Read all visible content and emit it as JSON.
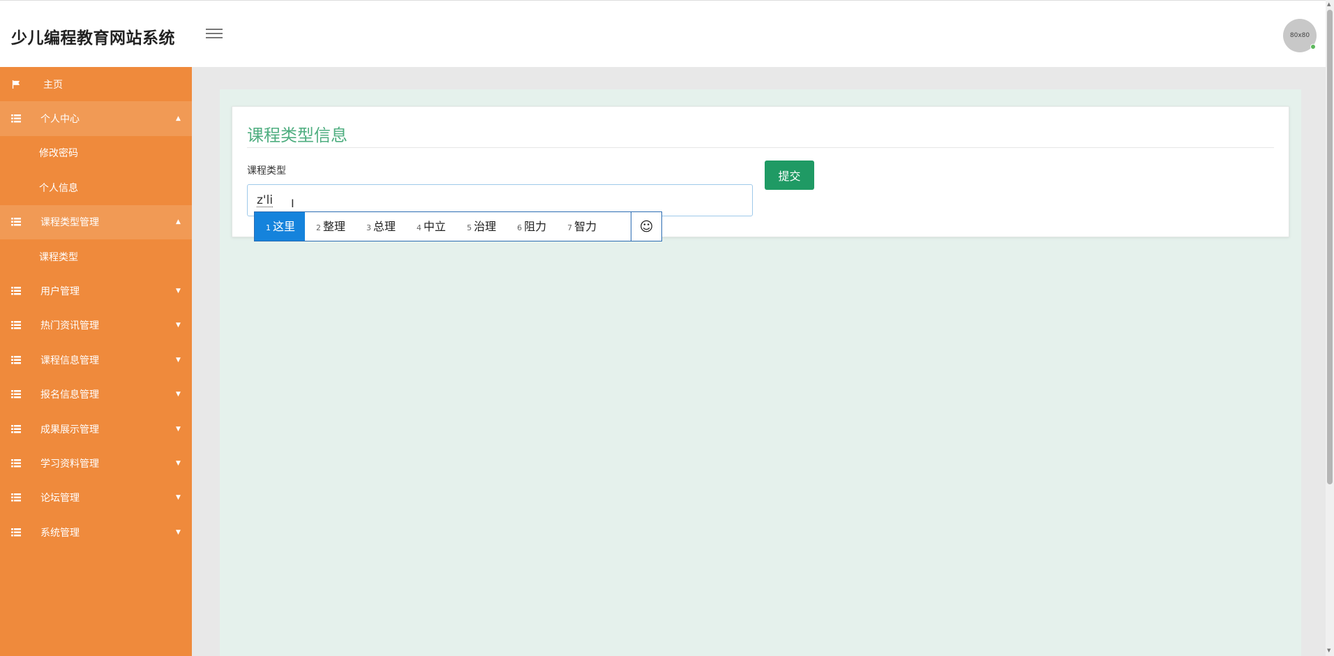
{
  "header": {
    "app_title": "少儿编程教育网站系统",
    "avatar_text": "80x80",
    "menu_icon": "hamburger-icon"
  },
  "sidebar": {
    "items": [
      {
        "label": "主页",
        "icon": "flag-icon",
        "arrow": ""
      },
      {
        "label": "个人中心",
        "icon": "grid-icon",
        "arrow": "▲",
        "expanded": true,
        "children": [
          {
            "label": "修改密码"
          },
          {
            "label": "个人信息"
          }
        ]
      },
      {
        "label": "课程类型管理",
        "icon": "grid-icon",
        "arrow": "▲",
        "expanded": true,
        "children": [
          {
            "label": "课程类型"
          }
        ]
      },
      {
        "label": "用户管理",
        "icon": "grid-icon",
        "arrow": "▼"
      },
      {
        "label": "热门资讯管理",
        "icon": "grid-icon",
        "arrow": "▼"
      },
      {
        "label": "课程信息管理",
        "icon": "grid-icon",
        "arrow": "▼"
      },
      {
        "label": "报名信息管理",
        "icon": "grid-icon",
        "arrow": "▼"
      },
      {
        "label": "成果展示管理",
        "icon": "grid-icon",
        "arrow": "▼"
      },
      {
        "label": "学习资料管理",
        "icon": "grid-icon",
        "arrow": "▼"
      },
      {
        "label": "论坛管理",
        "icon": "grid-icon",
        "arrow": "▼"
      },
      {
        "label": "系统管理",
        "icon": "grid-icon",
        "arrow": "▼"
      }
    ]
  },
  "form": {
    "title": "课程类型信息",
    "field_label": "课程类型",
    "field_value": "z'li",
    "submit_label": "提交"
  },
  "ime": {
    "candidates": [
      {
        "num": "1",
        "text": "这里"
      },
      {
        "num": "2",
        "text": "整理"
      },
      {
        "num": "3",
        "text": "总理"
      },
      {
        "num": "4",
        "text": "中立"
      },
      {
        "num": "5",
        "text": "治理"
      },
      {
        "num": "6",
        "text": "阻力"
      },
      {
        "num": "7",
        "text": "智力"
      }
    ],
    "selected_index": 0,
    "emoji_glyph": "☺"
  },
  "colors": {
    "sidebar_bg": "#ef8a3c",
    "sidebar_active_bg": "#f19a55",
    "accent_green": "#4fae80",
    "submit_bg": "#1f9a64",
    "ime_selected": "#1583dc"
  }
}
